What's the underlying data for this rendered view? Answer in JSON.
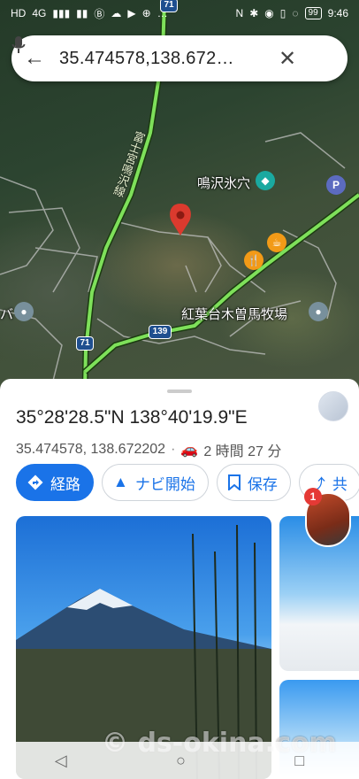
{
  "status_bar": {
    "left_indicators": [
      "HD",
      "4G",
      "▮▮▮",
      "▮▮",
      "Ⓑ",
      "☁",
      "▶",
      "⊕",
      "…"
    ],
    "right_indicators": [
      "N",
      "✱",
      "◉",
      "▯",
      "◌"
    ],
    "battery": "99",
    "time": "9:46"
  },
  "search": {
    "query": "35.474578,138.672…",
    "back_icon": "arrow-back-icon",
    "clear_icon": "close-icon",
    "mic_icon": "microphone-icon"
  },
  "map": {
    "labels": {
      "road_name": "富士宮鳴沢線",
      "cave": "鳴沢氷穴",
      "ranch": "紅葉台木曽馬牧場",
      "ba": "バ",
      "route_71_top": "71",
      "route_71_bottom": "71",
      "route_139": "139"
    },
    "pin_color": "#db3a2e"
  },
  "place": {
    "dms": "35°28'28.5\"N 138°40'19.9\"E",
    "decimal": "35.474578, 138.672202",
    "separator": "·",
    "drive_time": "2 時間 27 分"
  },
  "actions": {
    "directions": "経路",
    "navigate": "ナビ開始",
    "save": "保存",
    "share": "共"
  },
  "photos": {
    "badge_count": "1"
  },
  "watermark": "© ds-okina.com",
  "colors": {
    "accent": "#1a73e8",
    "route": "#7ee05a",
    "pin": "#db3a2e"
  }
}
